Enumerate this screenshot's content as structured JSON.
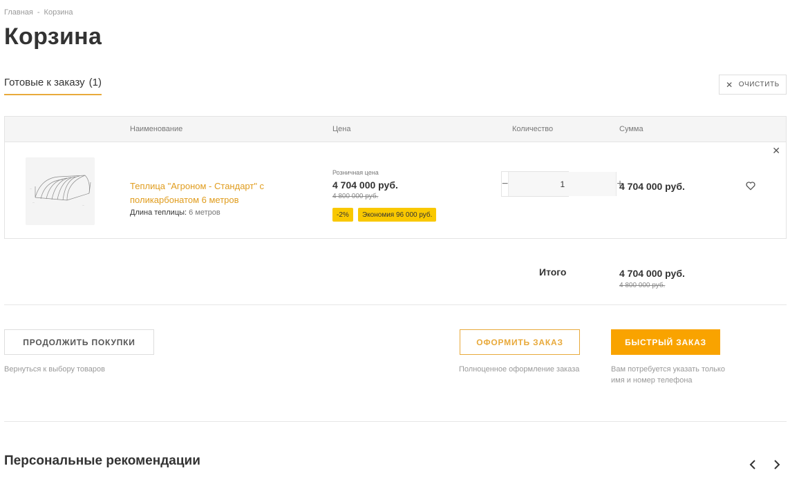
{
  "breadcrumb": {
    "home": "Главная",
    "separator": "-",
    "current": "Корзина"
  },
  "page": {
    "title": "Корзина"
  },
  "tabs": {
    "ready_label": "Готовые к заказу",
    "ready_count": "(1)"
  },
  "toolbar": {
    "clear_label": "ОЧИСТИТЬ"
  },
  "table": {
    "headers": {
      "name": "Наименование",
      "price": "Цена",
      "quantity": "Количество",
      "sum": "Сумма"
    },
    "rows": [
      {
        "name": "Теплица \"Агроном - Стандарт\" с поликарбонатом 6 метров",
        "prop_label": "Длина теплицы:",
        "prop_value": "6 метров",
        "price_label": "Розничная цена",
        "price": "4 704 000 руб.",
        "price_old": "4 800 000 руб.",
        "discount": "-2%",
        "economy": "Экономия 96 000 руб.",
        "quantity": "1",
        "sum": "4 704 000 руб."
      }
    ]
  },
  "totals": {
    "label": "Итого",
    "value": "4 704 000 руб.",
    "old": "4 800 000 руб."
  },
  "actions": {
    "continue_label": "ПРОДОЛЖИТЬ ПОКУПКИ",
    "continue_hint": "Вернуться к выбору товаров",
    "checkout_label": "ОФОРМИТЬ ЗАКАЗ",
    "checkout_hint": "Полноценное оформление заказа",
    "fast_label": "БЫСТРЫЙ ЗАКАЗ",
    "fast_hint": "Вам потребуется указать только имя и номер телефона"
  },
  "recommendations": {
    "title": "Персональные рекомендации"
  },
  "icons": {
    "clear": "close-icon",
    "row_remove": "close-icon",
    "favorite": "heart-icon",
    "qty_minus": "minus-icon",
    "qty_plus": "plus-icon",
    "prev": "chevron-left-icon",
    "next": "chevron-right-icon"
  },
  "colors": {
    "accent": "#e8a93a",
    "link": "#e09c1d",
    "badge": "#f9c800",
    "primary_button": "#f9a300"
  }
}
